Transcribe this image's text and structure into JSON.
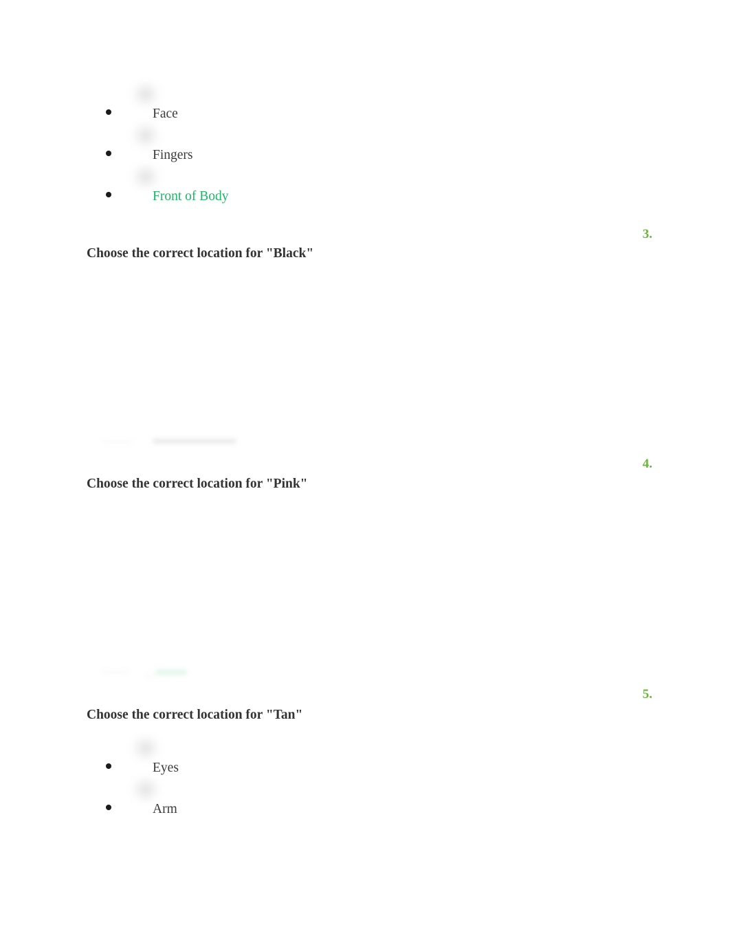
{
  "document": {
    "background_color": "#ffffff",
    "accent_number_color": "#6cb33f",
    "selected_answer_color": "#19b866",
    "body_text_color": "#3b3b3b"
  },
  "questions": [
    {
      "number": "",
      "title": "",
      "answers": [
        {
          "label": "Face",
          "selected": false,
          "thumb": "blurred-image-placeholder"
        },
        {
          "label": "Fingers",
          "selected": false,
          "thumb": "blurred-image-placeholder"
        },
        {
          "label": "Front of Body",
          "selected": true,
          "thumb": "blurred-image-placeholder"
        }
      ]
    },
    {
      "number": "3.",
      "title": "Choose the correct location for \"Black\"",
      "answers": []
    },
    {
      "number": "4.",
      "title": "Choose the correct location for \"Pink\"",
      "answers": []
    },
    {
      "number": "5.",
      "title": "Choose the correct location for \"Tan\"",
      "answers": [
        {
          "label": "Eyes",
          "selected": false,
          "thumb": "blurred-image-placeholder"
        },
        {
          "label": "Arm",
          "selected": false,
          "thumb": "blurred-image-placeholder"
        }
      ]
    }
  ]
}
